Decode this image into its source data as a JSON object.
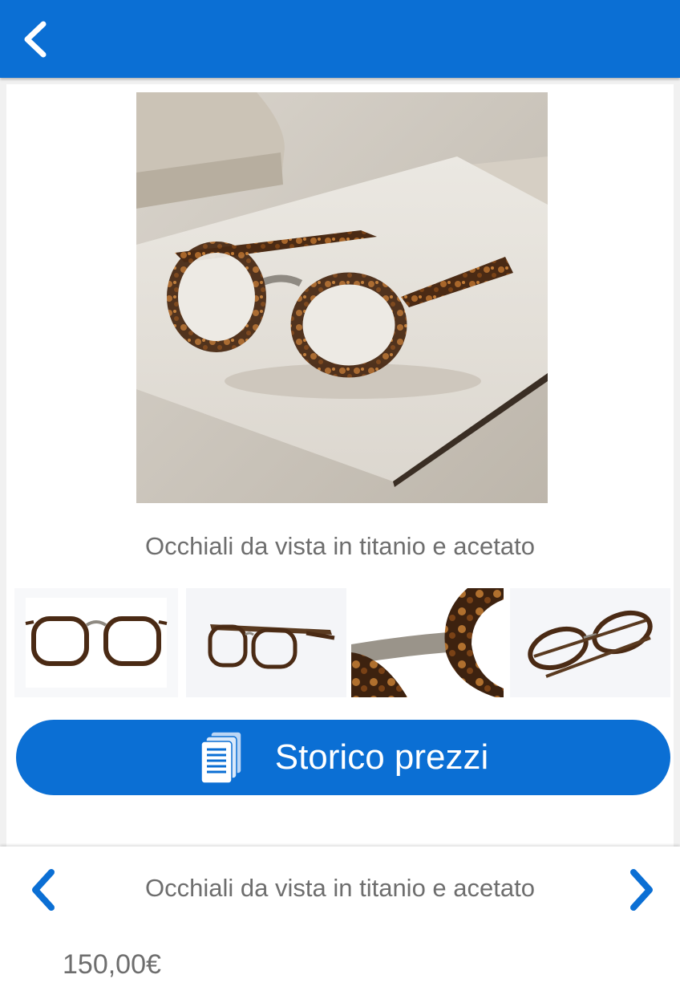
{
  "header": {
    "background_color": "#0b6fd4",
    "back_icon": "chevron-left-icon"
  },
  "product": {
    "title": "Occhiali da vista in titanio e acetato",
    "main_image": "eyeglasses-on-paper-photo",
    "thumbnails": [
      {
        "name": "thumbnail-front-view",
        "depicts": "glasses front view"
      },
      {
        "name": "thumbnail-angle-view",
        "depicts": "glasses three-quarter view"
      },
      {
        "name": "thumbnail-bridge-detail",
        "depicts": "bridge close-up"
      },
      {
        "name": "thumbnail-folded-view",
        "depicts": "glasses folded"
      }
    ]
  },
  "history_button": {
    "label": "Storico prezzi",
    "icon": "documents-icon",
    "color": "#0b6fd4"
  },
  "bottom_nav": {
    "prev_icon": "chevron-left-icon",
    "next_icon": "chevron-right-icon",
    "title": "Occhiali da vista in titanio e acetato",
    "price": "150,00€",
    "accent_color": "#0b6fd4"
  }
}
